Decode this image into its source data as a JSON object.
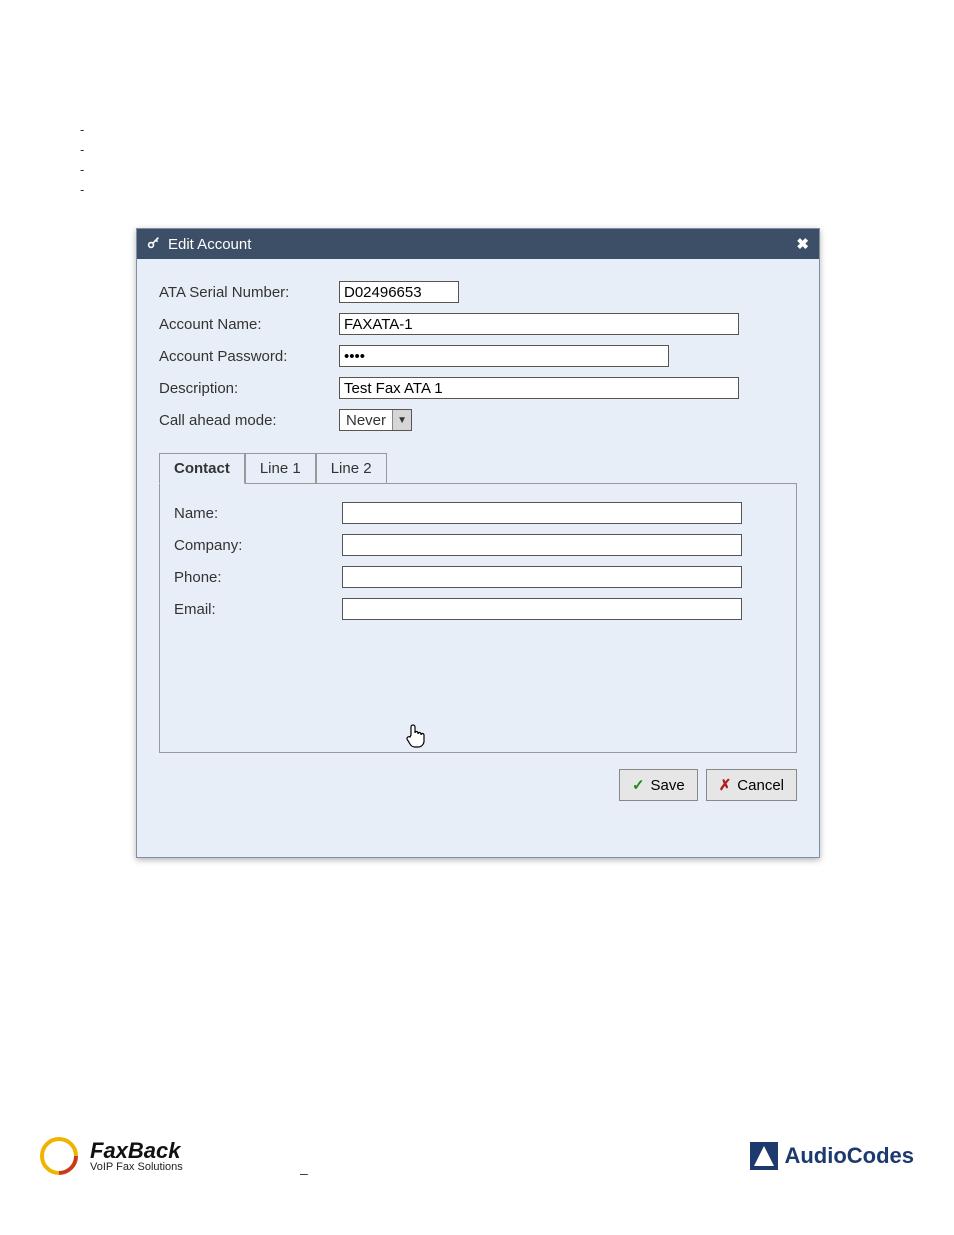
{
  "dialog": {
    "title": "Edit Account",
    "fields": {
      "serial_label": "ATA Serial Number:",
      "serial_value": "D02496653",
      "account_label": "Account Name:",
      "account_value": "FAXATA-1",
      "password_label": "Account Password:",
      "password_value": "pass",
      "description_label": "Description:",
      "description_value": "Test Fax ATA 1",
      "callahead_label": "Call ahead mode:",
      "callahead_value": "Never"
    },
    "tabs": {
      "contact": "Contact",
      "line1": "Line 1",
      "line2": "Line 2"
    },
    "contact_panel": {
      "name_label": "Name:",
      "name_value": "",
      "company_label": "Company:",
      "company_value": "",
      "phone_label": "Phone:",
      "phone_value": "",
      "email_label": "Email:",
      "email_value": ""
    },
    "buttons": {
      "save": "Save",
      "cancel": "Cancel"
    }
  },
  "footer": {
    "faxback_brand": "FaxBack",
    "faxback_tagline": "VoIP Fax Solutions",
    "audiocodes_brand": "AudioCodes"
  }
}
